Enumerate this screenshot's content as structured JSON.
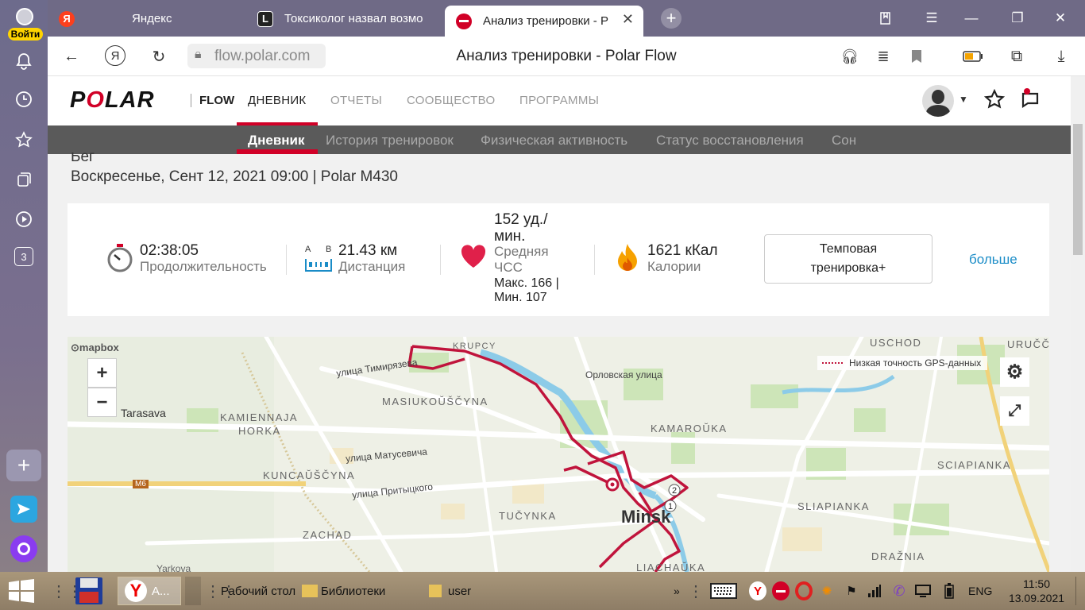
{
  "sidebar": {
    "login_label": "Войти",
    "badge_count": "3"
  },
  "tabs": [
    {
      "label": "Яндекс",
      "favicon": "Я"
    },
    {
      "label": "Токсиколог назвал возмо",
      "favicon": "L"
    },
    {
      "label": "Анализ тренировки - P",
      "favicon": ""
    }
  ],
  "address": {
    "url": "flow.polar.com",
    "page_title": "Анализ тренировки - Polar Flow"
  },
  "polar": {
    "logo": "POLAR",
    "flow": "FLOW",
    "nav": [
      "ДНЕВНИК",
      "ОТЧЕТЫ",
      "СООБЩЕСТВО",
      "ПРОГРАММЫ"
    ],
    "subnav": [
      "Дневник",
      "История тренировок",
      "Физическая активность",
      "Статус восстановления",
      "Сон"
    ]
  },
  "activity": {
    "type": "Бег",
    "date": "Воскресенье, Сент 12, 2021 09:00 | Polar M430"
  },
  "summary": {
    "duration_value": "02:38:05",
    "duration_label": "Продолжительность",
    "dist_a": "A",
    "dist_b": "B",
    "distance_value": "21.43 км",
    "distance_label": "Дистанция",
    "hr_value_1": "152 уд./",
    "hr_value_2": "мин.",
    "hr_label_1": "Средняя",
    "hr_label_2": "ЧСС",
    "hr_max": "Макс. 166  |",
    "hr_min": "Мин. 107",
    "cal_value": "1621 кКал",
    "cal_label": "Калории",
    "tempo_1": "Темповая",
    "tempo_2": "тренировка+",
    "more": "больше"
  },
  "map": {
    "attribution": "mapbox",
    "legend": "Низкая точность GPS-данных",
    "zoom_in": "+",
    "zoom_out": "−",
    "marker_1": "1",
    "marker_2": "2",
    "labels": [
      "KRUPCY",
      "USCHOD",
      "URUČČ",
      "MASIUKOŬŠČYNA",
      "KAMIENNAJA",
      "HORKA",
      "Tarasava",
      "KAMAROŬKA",
      "SCIAPIANKA",
      "KUNCAŬŠČYNA",
      "TUČYNKA",
      "SLIAPIANKA",
      "ZACHAD",
      "Minsk",
      "DRAŽNIA",
      "LIACHAŬKA",
      "Yarkova",
      "M6"
    ],
    "streets": [
      "улица Тимирязева",
      "Орловская улица",
      "улица Матусевича",
      "улица Притыцкого"
    ]
  },
  "taskbar": {
    "app_label": "А...",
    "desktop": "Рабочий стол",
    "libraries": "Библиотеки",
    "user": "user",
    "lang": "ENG",
    "time": "11:50",
    "date": "13.09.2021"
  }
}
